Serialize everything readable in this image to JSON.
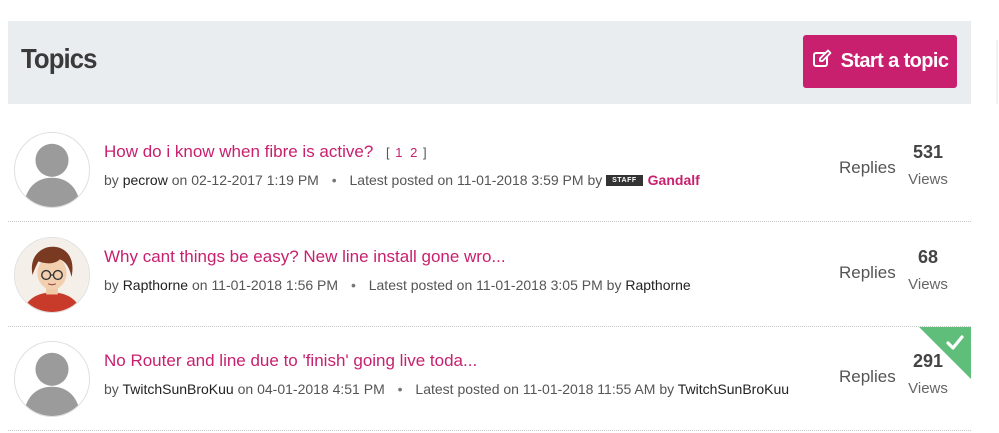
{
  "header": {
    "title": "Topics",
    "start_label": "Start a topic"
  },
  "topics": [
    {
      "subject": "How do i know when fibre is active?",
      "pages": [
        "1",
        "2"
      ],
      "by_word": "by",
      "author": "pecrow",
      "on_word": "on",
      "date": "02-12-2017 1:19 PM",
      "latest_label": "Latest posted on",
      "latest_date": "11-01-2018 3:59 PM",
      "latest_by_word": "by",
      "latest_badge": "STAFF",
      "latest_user": "Gandalf",
      "replies_label": "Replies",
      "views": "531",
      "views_label": "Views"
    },
    {
      "subject": "Why cant things be easy? New line install gone wro...",
      "by_word": "by",
      "author": "Rapthorne",
      "on_word": "on",
      "date": "11-01-2018 1:56 PM",
      "latest_label": "Latest posted on",
      "latest_date": "11-01-2018 3:05 PM",
      "latest_by_word": "by",
      "latest_user": "Rapthorne",
      "replies_label": "Replies",
      "views": "68",
      "views_label": "Views"
    },
    {
      "subject": "No Router and line due to 'finish' going live toda...",
      "by_word": "by",
      "author": "TwitchSunBroKuu",
      "on_word": "on",
      "date": "04-01-2018 4:51 PM",
      "latest_label": "Latest posted on",
      "latest_date": "11-01-2018 11:55 AM",
      "latest_by_word": "by",
      "latest_user": "TwitchSunBroKuu",
      "replies_label": "Replies",
      "views": "291",
      "views_label": "Views",
      "solved": true
    }
  ],
  "colors": {
    "accent": "#c8206e",
    "header_bg": "#e9edf0",
    "solved": "#5fbf7a"
  },
  "icons": {
    "start": "edit-icon",
    "solved": "checkmark-icon",
    "default_avatar": "default-avatar-icon"
  }
}
